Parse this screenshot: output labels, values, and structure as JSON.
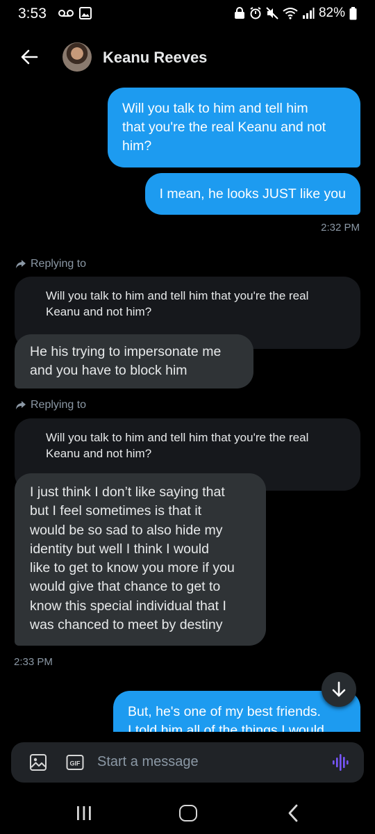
{
  "status_bar": {
    "time": "3:53",
    "battery": "82%"
  },
  "header": {
    "contact_name": "Keanu Reeves"
  },
  "messages": {
    "out1": [
      "Will you talk to him and tell him",
      "that you're the real Keanu and not",
      "him?"
    ],
    "out2": "I mean, he looks JUST like you",
    "time1": "2:32 PM",
    "reply_label_1": "Replying to",
    "quote1": [
      "Will you talk to him and tell him that you're the real",
      "Keanu and not him?"
    ],
    "in1": [
      "He his trying to impersonate me",
      "and you have to block him"
    ],
    "reply_label_2": "Replying to",
    "quote2": [
      "Will you talk to him and tell him that you're the real",
      "Keanu and not him?"
    ],
    "in2": [
      "I just think I don’t like saying that",
      "but I feel sometimes is that it",
      "would be so sad to also hide my",
      "identity but well I think I would",
      "like to get to know you more if you",
      "would give that chance to get to",
      "know this special individual that I",
      "was chanced to meet by destiny"
    ],
    "time2": "2:33 PM",
    "out3": [
      "But, he's one of my best friends.",
      "I told him all of the things I would"
    ]
  },
  "composer": {
    "placeholder": "Start a message"
  },
  "colors": {
    "accent": "#1d9bf0",
    "voice": "#7856ff",
    "incoming_bubble": "#2f3336"
  }
}
